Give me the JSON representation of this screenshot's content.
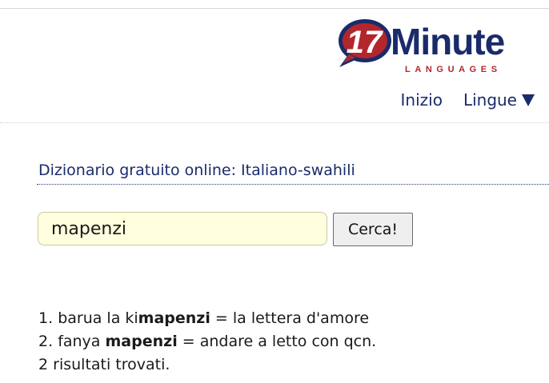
{
  "colors": {
    "brand_navy": "#1a2b6b",
    "brand_red": "#b3262c",
    "input_background": "#ffffdf"
  },
  "logo": {
    "number": "17",
    "word": "Minute",
    "sub": "LANGUAGES"
  },
  "nav": {
    "home_label": "Inizio",
    "languages_label": "Lingue",
    "languages_icon": "triangle-down-icon"
  },
  "heading": "Dizionario gratuito online: Italiano-swahili",
  "search": {
    "value": "mapenzi",
    "button_label": "Cerca!"
  },
  "results": {
    "items": [
      {
        "number": "1.",
        "pre": "barua la ki",
        "match": "mapenzi",
        "post": "",
        "separator": " = ",
        "translation": "la lettera d'amore"
      },
      {
        "number": "2.",
        "pre": "fanya ",
        "match": "mapenzi",
        "post": "",
        "separator": " = ",
        "translation": "andare a letto con qcn."
      }
    ],
    "summary": "2 risultati trovati."
  }
}
